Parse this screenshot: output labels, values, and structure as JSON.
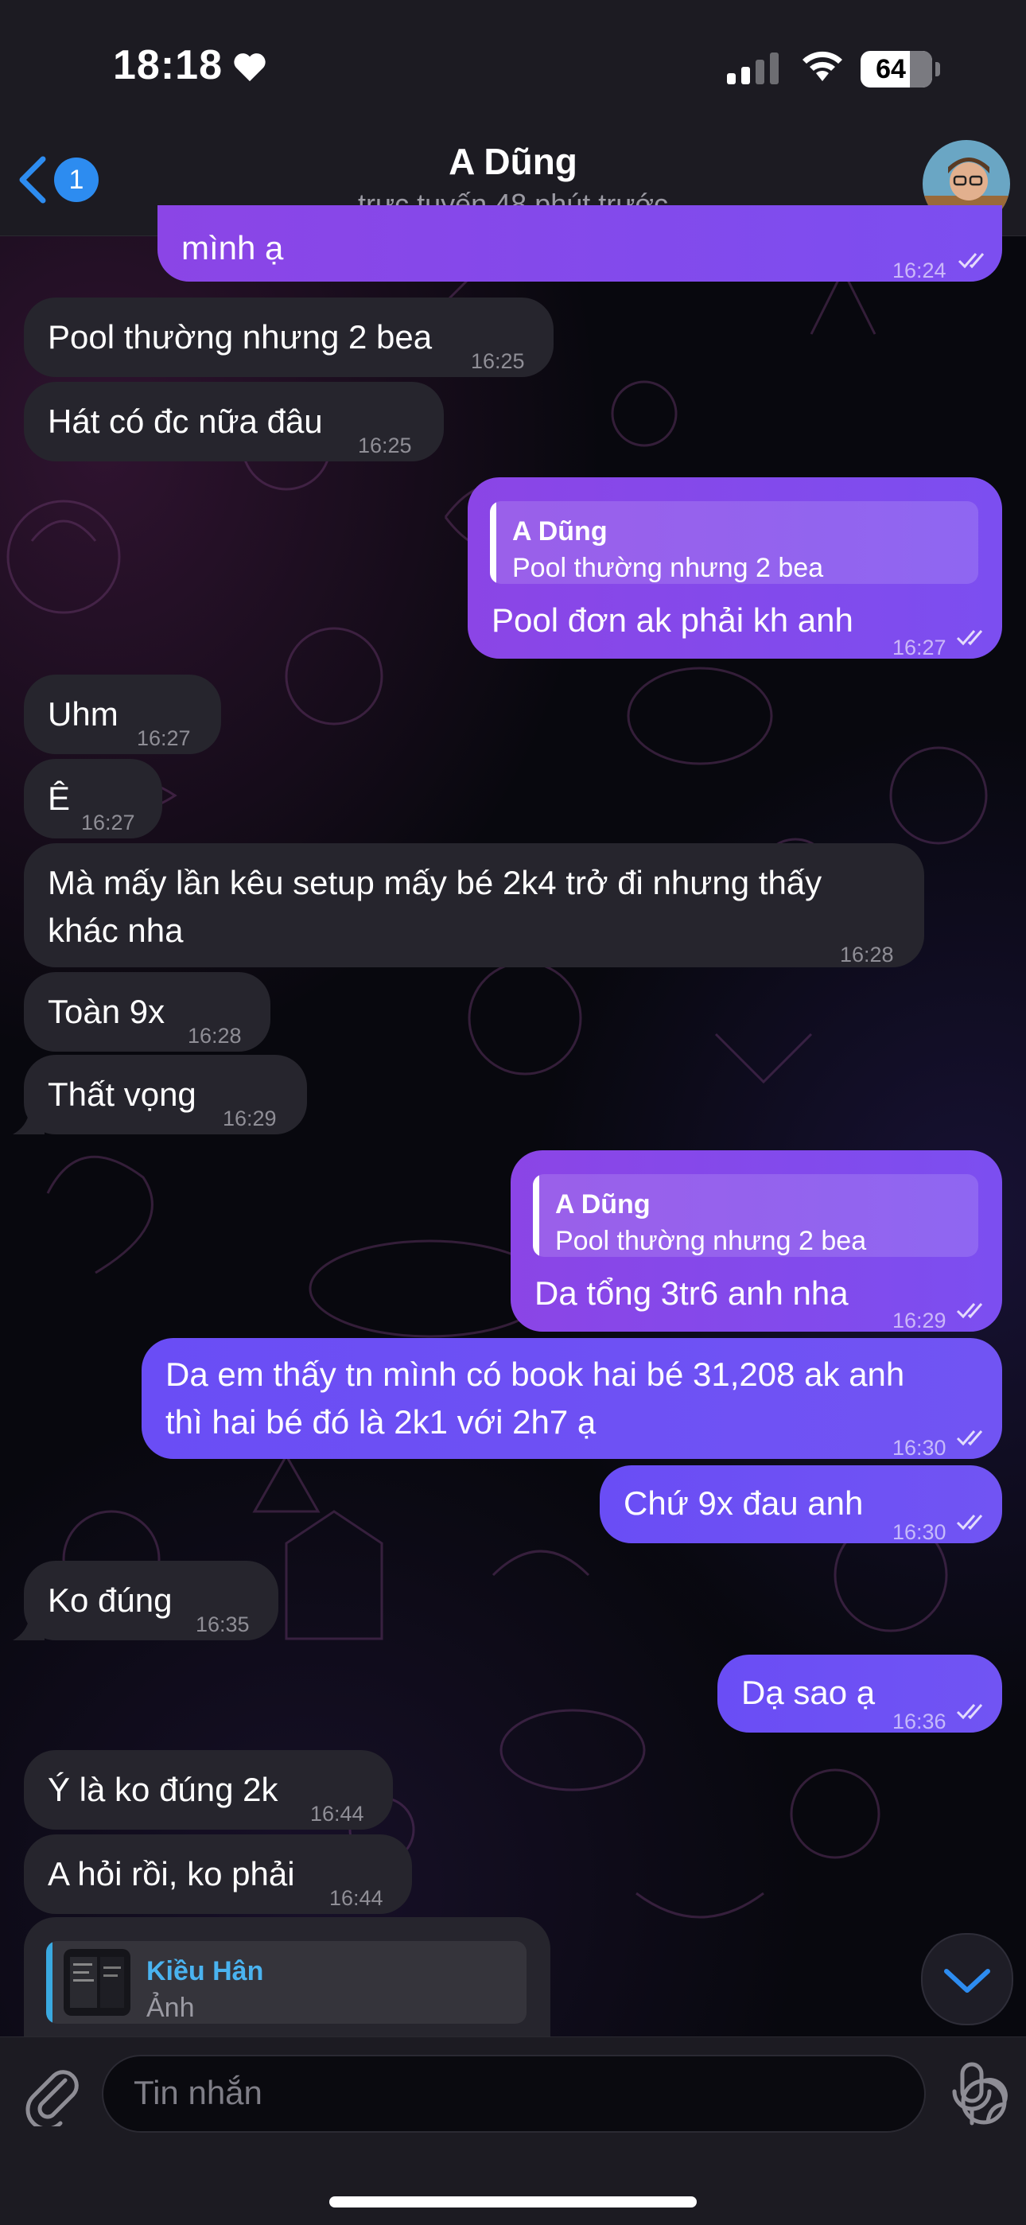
{
  "status_bar": {
    "time": "18:18",
    "battery": "64"
  },
  "header": {
    "back_badge": "1",
    "title": "A Dũng",
    "subtitle": "trực tuyến 48 phút trước"
  },
  "colors": {
    "outgoing_bubble": "#8b45e6",
    "outgoing_bubble_alt": "#6a4df5",
    "incoming_bubble": "#26252d",
    "accent_blue": "#2d8cf0"
  },
  "messages": [
    {
      "direction": "out",
      "text": "mình ạ",
      "time": "16:24"
    },
    {
      "direction": "in",
      "text": "Pool thường nhưng 2 bea",
      "time": "16:25"
    },
    {
      "direction": "in",
      "text": "Hát có đc nữa đâu",
      "time": "16:25"
    },
    {
      "direction": "out",
      "reply_name": "A Dũng",
      "reply_text": "Pool thường nhưng 2 bea",
      "text": "Pool đơn ak phải kh anh",
      "time": "16:27"
    },
    {
      "direction": "in",
      "text": "Uhm",
      "time": "16:27"
    },
    {
      "direction": "in",
      "text": "Ê",
      "time": "16:27"
    },
    {
      "direction": "in",
      "text_line1": "Mà mấy lần kêu setup mấy bé 2k4 trở đi nhưng thấy",
      "text_line2": "khác nha",
      "time": "16:28"
    },
    {
      "direction": "in",
      "text": "Toàn 9x",
      "time": "16:28"
    },
    {
      "direction": "in",
      "text": "Thất vọng",
      "time": "16:29"
    },
    {
      "direction": "out",
      "reply_name": "A Dũng",
      "reply_text": "Pool thường nhưng 2 bea",
      "text": "Da tổng 3tr6 anh nha",
      "time": "16:29"
    },
    {
      "direction": "out",
      "text_line1": "Da em thấy tn mình có book hai bé 31,208 ak anh",
      "text_line2": "thì hai bé đó là 2k1 với 2h7 ạ",
      "time": "16:30"
    },
    {
      "direction": "out",
      "text": "Chứ 9x đau anh",
      "time": "16:30"
    },
    {
      "direction": "in",
      "text": "Ko đúng",
      "time": "16:35"
    },
    {
      "direction": "out",
      "text": "Dạ sao ạ",
      "time": "16:36"
    },
    {
      "direction": "in",
      "text": "Ý là ko đúng 2k",
      "time": "16:44"
    },
    {
      "direction": "in",
      "text": "A hỏi rồi, ko phải",
      "time": "16:44"
    },
    {
      "direction": "in",
      "reply_name": "Kiều Hân",
      "reply_text": "Ảnh"
    }
  ],
  "input": {
    "placeholder": "Tin nhắn"
  }
}
